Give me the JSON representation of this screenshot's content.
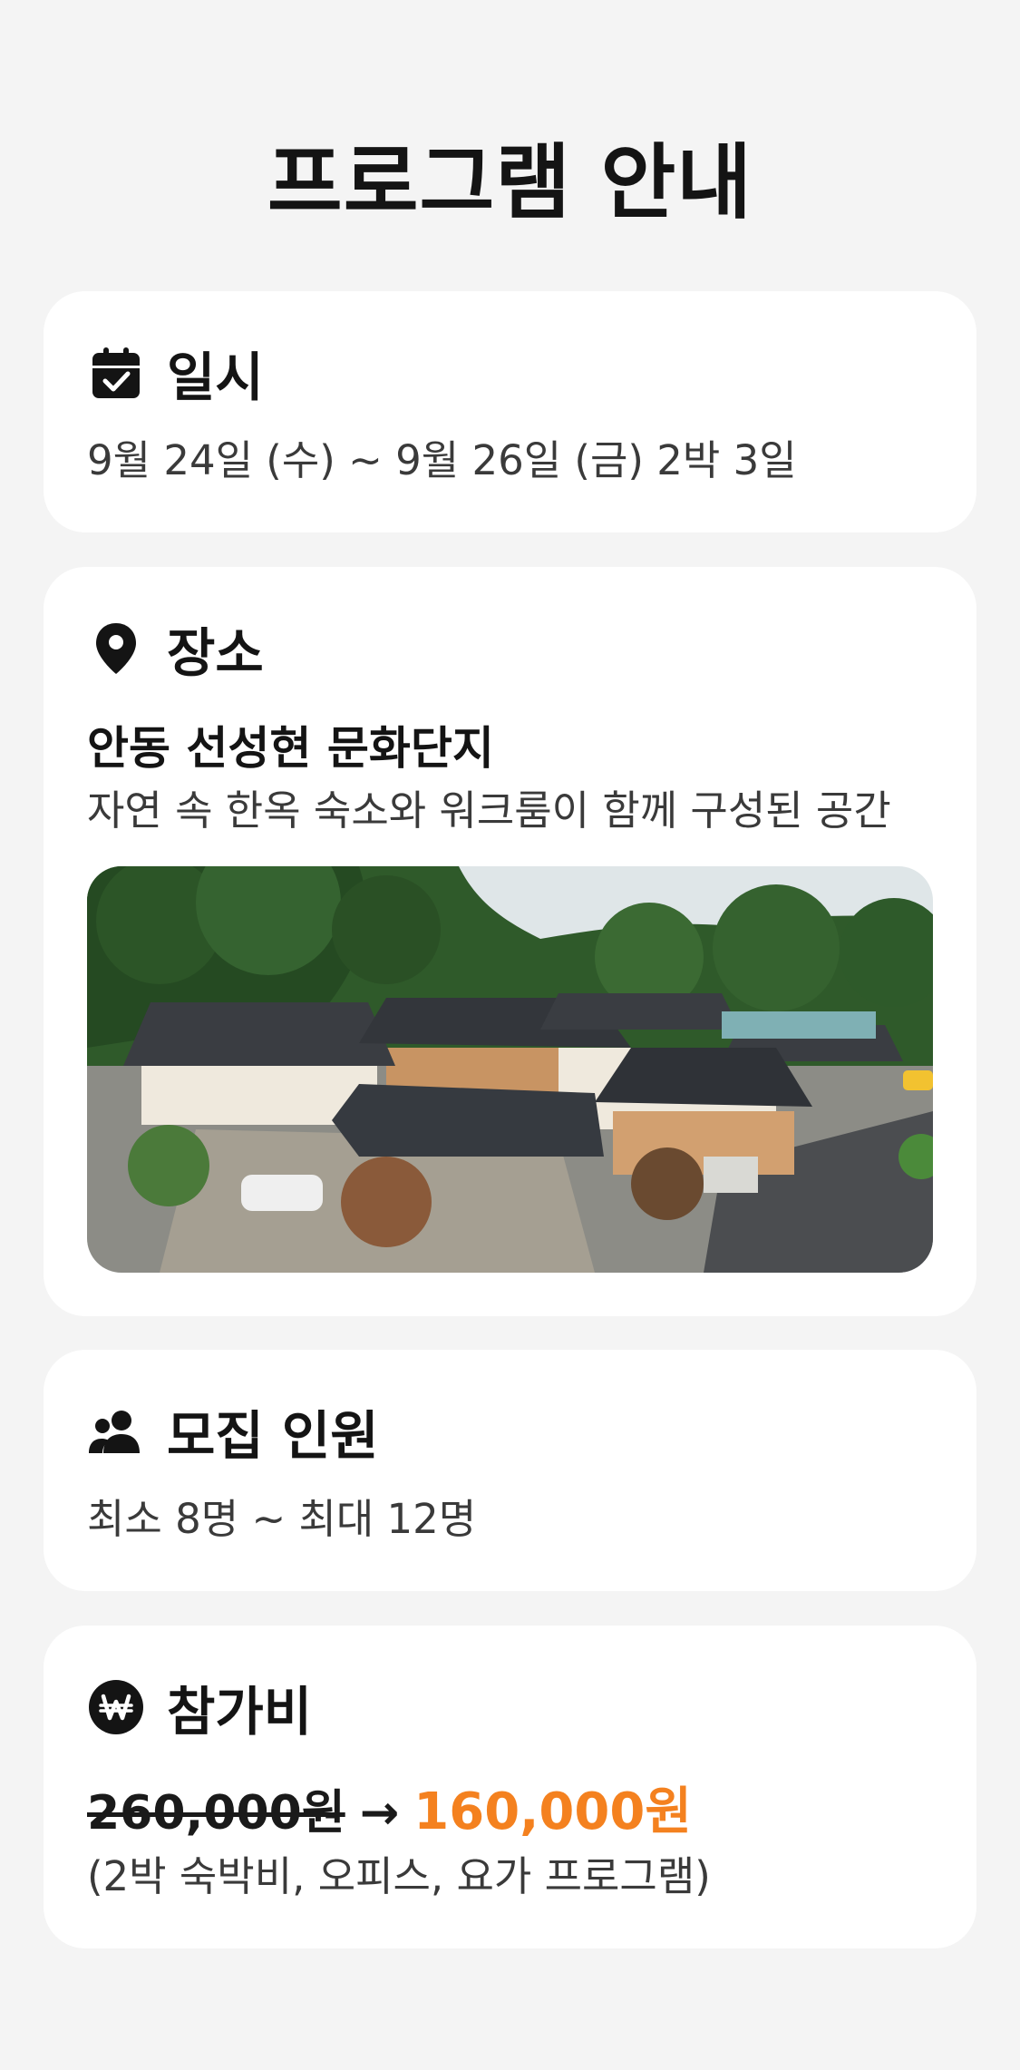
{
  "page": {
    "title": "프로그램 안내"
  },
  "schedule": {
    "icon": "calendar-check-icon",
    "title": "일시",
    "text": "9월 24일 (수) ~ 9월 26일 (금) 2박 3일"
  },
  "venue": {
    "icon": "map-pin-icon",
    "title": "장소",
    "name": "안동 선성현 문화단지",
    "description": "자연 속 한옥 숙소와 워크룸이 함께 구성된 공간",
    "photo": "hanok-complex-aerial-photo"
  },
  "recruitment": {
    "icon": "users-icon",
    "title": "모집 인원",
    "text": "최소 8명 ~ 최대 12명"
  },
  "fee": {
    "icon": "won-coin-icon",
    "title": "참가비",
    "old_price": "260,000원",
    "arrow": "→",
    "new_price": "160,000원",
    "includes": "(2박 숙박비, 오피스, 요가 프로그램)"
  },
  "colors": {
    "background": "#f4f4f4",
    "card": "#ffffff",
    "accent": "#f4811f",
    "text": "#141414"
  }
}
